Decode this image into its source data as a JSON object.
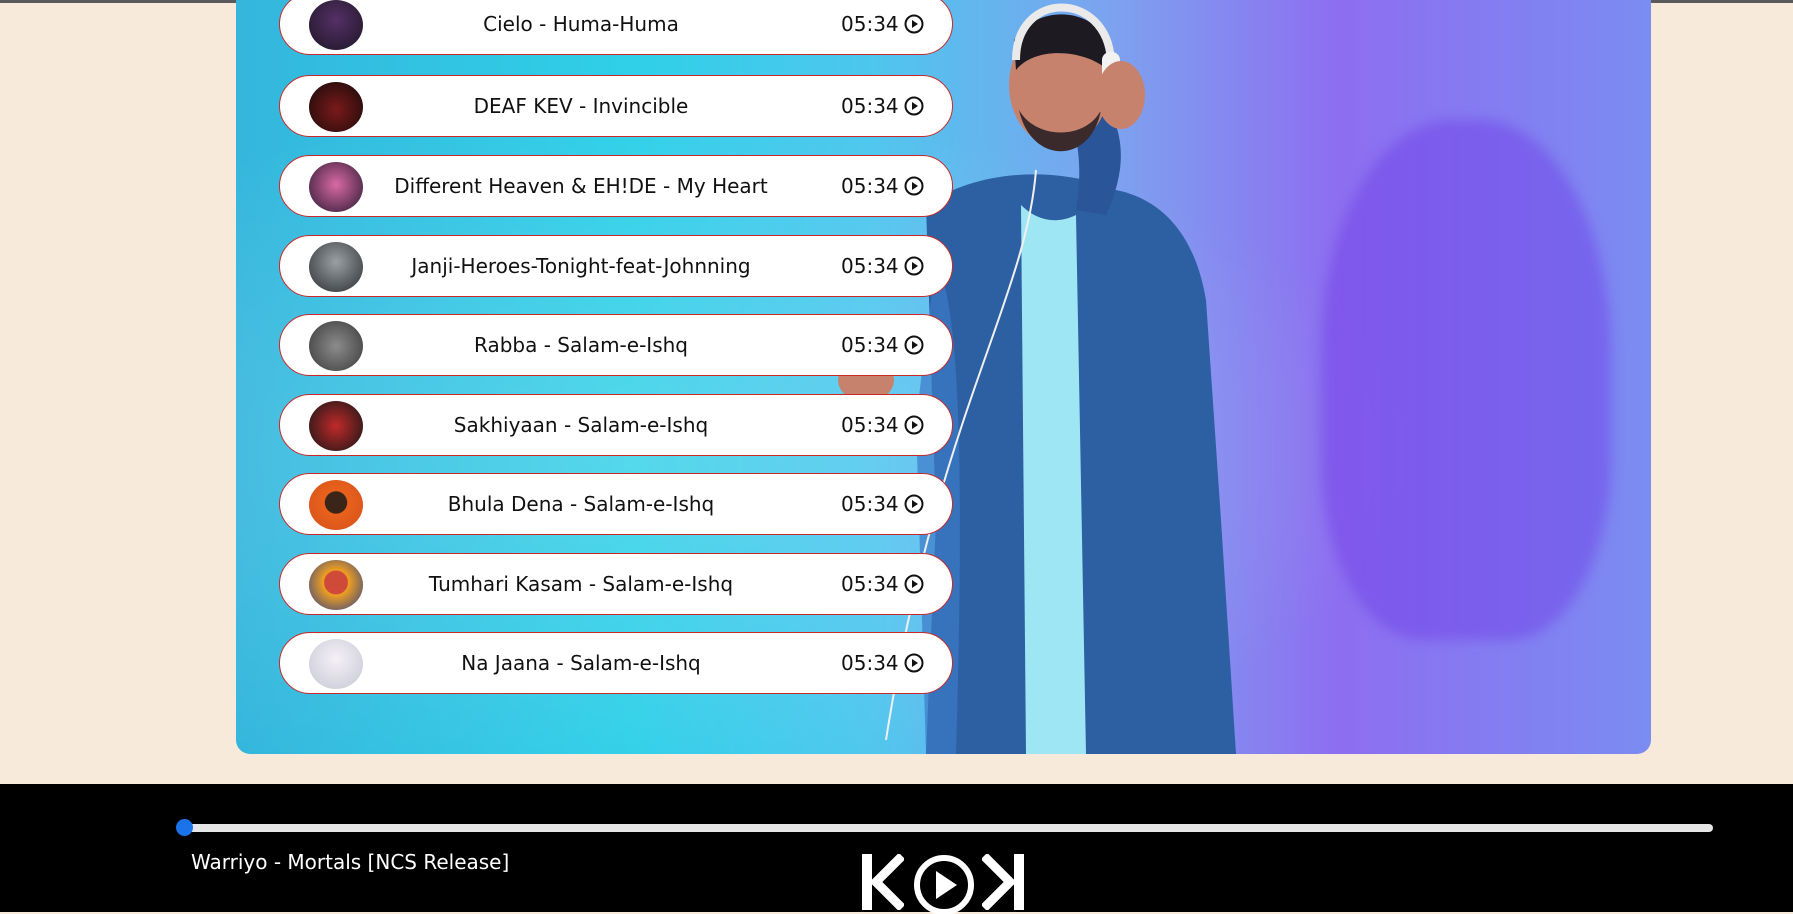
{
  "playlist": [
    {
      "title": "Cielo - Huma-Huma",
      "duration": "05:34",
      "cover": "cover-icon"
    },
    {
      "title": "DEAF KEV - Invincible",
      "duration": "05:34",
      "cover": "cover-icon"
    },
    {
      "title": "Different Heaven & EH!DE - My Heart",
      "duration": "05:34",
      "cover": "cover-icon"
    },
    {
      "title": "Janji-Heroes-Tonight-feat-Johnning",
      "duration": "05:34",
      "cover": "cover-icon"
    },
    {
      "title": "Rabba - Salam-e-Ishq",
      "duration": "05:34",
      "cover": "cover-icon"
    },
    {
      "title": "Sakhiyaan - Salam-e-Ishq",
      "duration": "05:34",
      "cover": "cover-icon"
    },
    {
      "title": "Bhula Dena - Salam-e-Ishq",
      "duration": "05:34",
      "cover": "cover-icon"
    },
    {
      "title": "Tumhari Kasam - Salam-e-Ishq",
      "duration": "05:34",
      "cover": "cover-icon"
    },
    {
      "title": "Na Jaana - Salam-e-Ishq",
      "duration": "05:34",
      "cover": "cover-icon"
    }
  ],
  "player": {
    "now_playing": "Warriyo - Mortals [NCS Release]",
    "progress": 0.0,
    "controls": [
      "previous-icon",
      "play-icon",
      "next-icon"
    ]
  },
  "colors": {
    "page_bg": "#f8eadb",
    "item_border": "#c82a2a",
    "player_bg": "#000000",
    "progress_knob": "#1a73e8"
  }
}
